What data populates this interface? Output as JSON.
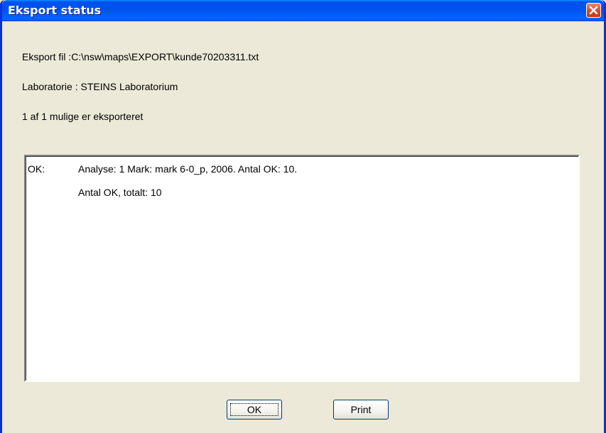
{
  "window": {
    "title": "Eksport status",
    "close_icon": "close-icon"
  },
  "info": {
    "export_file": "Eksport fil :C:\\nsw\\maps\\EXPORT\\kunde70203311.txt",
    "laboratory": "Laboratorie : STEINS Laboratorium",
    "summary": "1 af 1 mulige er eksporteret"
  },
  "log": {
    "rows": [
      {
        "status": "OK:",
        "message": "Analyse:  1 Mark: mark 6-0_p, 2006. Antal OK: 10."
      },
      {
        "status": "",
        "message": "Antal OK, totalt: 10"
      }
    ]
  },
  "buttons": {
    "ok_label": "OK",
    "print_label": "Print"
  },
  "colors": {
    "title_bar": "#0054e3",
    "window_border": "#0831d9",
    "dialog_background": "#ece9d8",
    "close_button": "#d8502d"
  }
}
